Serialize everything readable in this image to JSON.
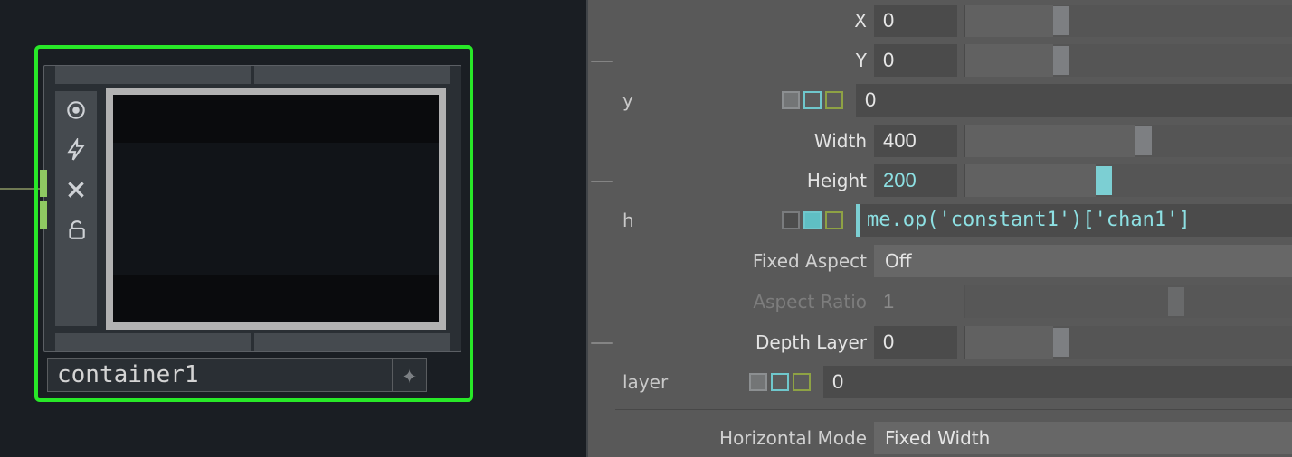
{
  "node": {
    "name": "container1"
  },
  "params": {
    "X": {
      "label": "X",
      "value": "0",
      "slider_pos": 0.27
    },
    "Y": {
      "label": "Y",
      "value": "0",
      "slider_pos": 0.27
    },
    "y_group": {
      "code": "y",
      "value": "0"
    },
    "Width": {
      "label": "Width",
      "value": "400",
      "slider_pos": 0.52
    },
    "Height": {
      "label": "Height",
      "value": "200",
      "slider_pos": 0.4
    },
    "h_group": {
      "code": "h",
      "expr": "me.op('constant1')['chan1']"
    },
    "FixedAspect": {
      "label": "Fixed Aspect",
      "value": "Off"
    },
    "AspectRatio": {
      "label": "Aspect Ratio",
      "value": "1",
      "slider_pos": 0.62
    },
    "DepthLayer": {
      "label": "Depth Layer",
      "value": "0",
      "slider_pos": 0.27
    },
    "layer_group": {
      "code": "layer",
      "value": "0"
    },
    "HorizMode": {
      "label": "Horizontal Mode",
      "value": "Fixed Width"
    }
  }
}
